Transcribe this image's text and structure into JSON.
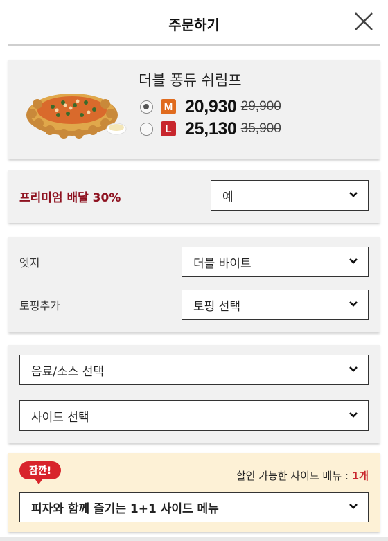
{
  "header": {
    "title": "주문하기",
    "close_icon": "close-icon"
  },
  "product": {
    "name": "더블 퐁듀 쉬림프",
    "sizes": [
      {
        "label": "M",
        "price": "20,930",
        "original_price": "29,900",
        "selected": true,
        "color": "#e06b1e"
      },
      {
        "label": "L",
        "price": "25,130",
        "original_price": "35,900",
        "selected": false,
        "color": "#c8262d"
      }
    ]
  },
  "premium_delivery": {
    "label": "프리미엄 배달 30%",
    "value": "예"
  },
  "options": {
    "edge": {
      "label": "엣지",
      "value": "더블 바이트"
    },
    "topping": {
      "label": "토핑추가",
      "value": "토핑 선택"
    }
  },
  "side_selects": {
    "drink_sauce": "음료/소스 선택",
    "side": "사이드 선택"
  },
  "promo": {
    "badge": "잠깐!",
    "text_prefix": "할인 가능한 사이드 메뉴 : ",
    "count": "1개",
    "select": "피자와 함께 즐기는 1+1 사이드 메뉴"
  },
  "colors": {
    "accent_red": "#c8262d",
    "premium_label": "#8e1220",
    "promo_bg": "#fdf1d6"
  }
}
